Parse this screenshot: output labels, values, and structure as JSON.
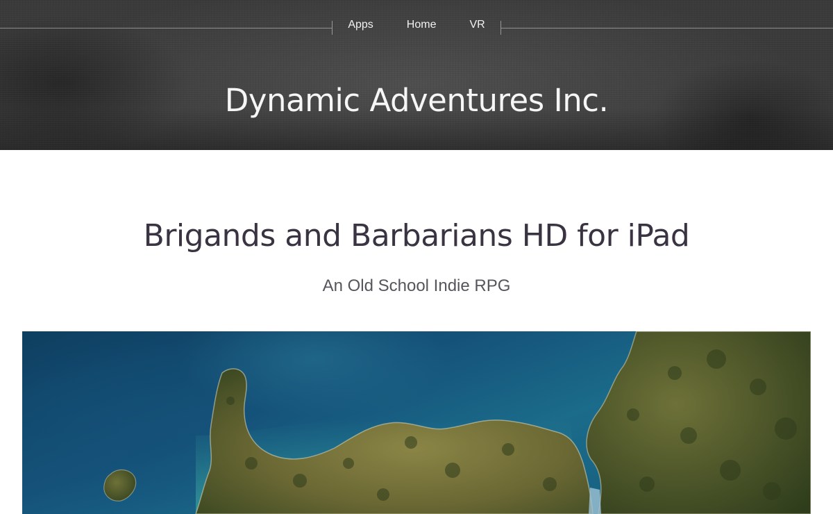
{
  "header": {
    "nav": [
      {
        "label": "Apps"
      },
      {
        "label": "Home"
      },
      {
        "label": "VR"
      }
    ],
    "site_title": "Dynamic Adventures Inc."
  },
  "main": {
    "title": "Brigands and Barbarians HD for iPad",
    "subtitle": "An Old School Indie RPG"
  },
  "colors": {
    "header_bg": "#3d3d3d",
    "title_text": "#3a3442",
    "subtitle_text": "#55555c",
    "sea": "#15527a",
    "land": "#6e6a36"
  }
}
